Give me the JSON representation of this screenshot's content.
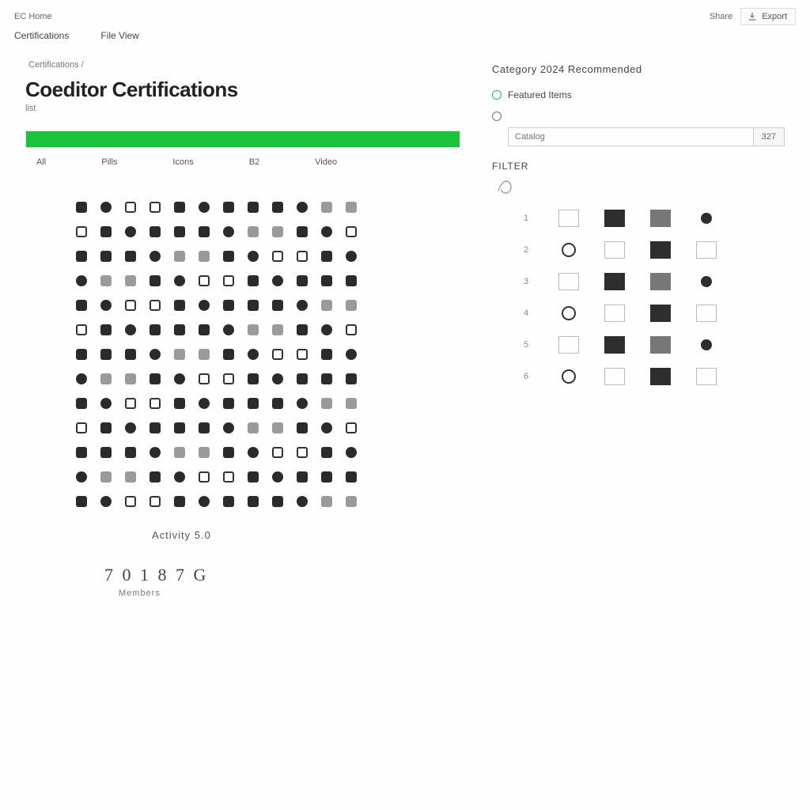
{
  "topbar": {
    "left_a": "EC  Home",
    "left_b": "",
    "right_link": "Share",
    "box_label": "Export"
  },
  "menu": {
    "a": "Certifications",
    "b": "File  View"
  },
  "breadcrumb": "Certifications /",
  "title": "Coeditor Certifications",
  "subtitle": "list",
  "progress": {
    "percent": 100
  },
  "tabs": [
    "All",
    "Pills",
    "Icons",
    "B2",
    "Video"
  ],
  "caption": "Activity  5.0",
  "big_number": "7 0 1 8 7 G",
  "big_sub": "Members",
  "right": {
    "heading": "Category 2024  Recommended",
    "item_featured": "Featured  Items",
    "item_catalog_placeholder": "Catalog",
    "item_catalog_tag": "327",
    "label": "Filter",
    "small_grid_rows": [
      "1",
      "2",
      "3",
      "4",
      "5",
      "6"
    ]
  }
}
